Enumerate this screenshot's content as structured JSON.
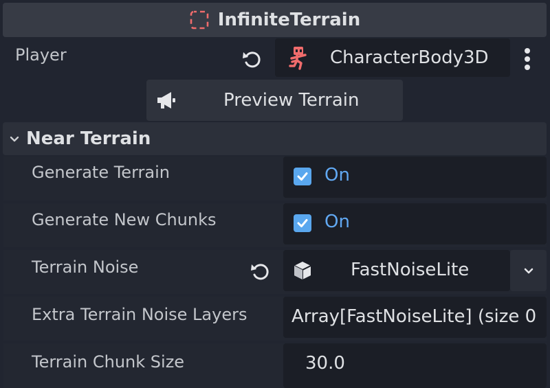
{
  "header": {
    "title": "InfiniteTerrain",
    "icon": "node-icon"
  },
  "player": {
    "label": "Player",
    "value": "CharacterBody3D",
    "value_icon": "character-body-icon"
  },
  "preview_button": {
    "label": "Preview Terrain",
    "icon": "megaphone-icon"
  },
  "section": {
    "title": "Near Terrain",
    "expanded": true
  },
  "properties": {
    "generate_terrain": {
      "label": "Generate Terrain",
      "checked": true,
      "value": "On"
    },
    "generate_new_chunks": {
      "label": "Generate New Chunks",
      "checked": true,
      "value": "On"
    },
    "terrain_noise": {
      "label": "Terrain Noise",
      "value": "FastNoiseLite",
      "value_icon": "resource-cube-icon"
    },
    "extra_noise_layers": {
      "label": "Extra Terrain Noise Layers",
      "value": "Array[FastNoiseLite] (size 0"
    },
    "terrain_chunk_size": {
      "label": "Terrain Chunk Size",
      "value": "30.0"
    }
  },
  "colors": {
    "background": "#212530",
    "accent": "#61a8f2",
    "node_red": "#f06c6c"
  }
}
